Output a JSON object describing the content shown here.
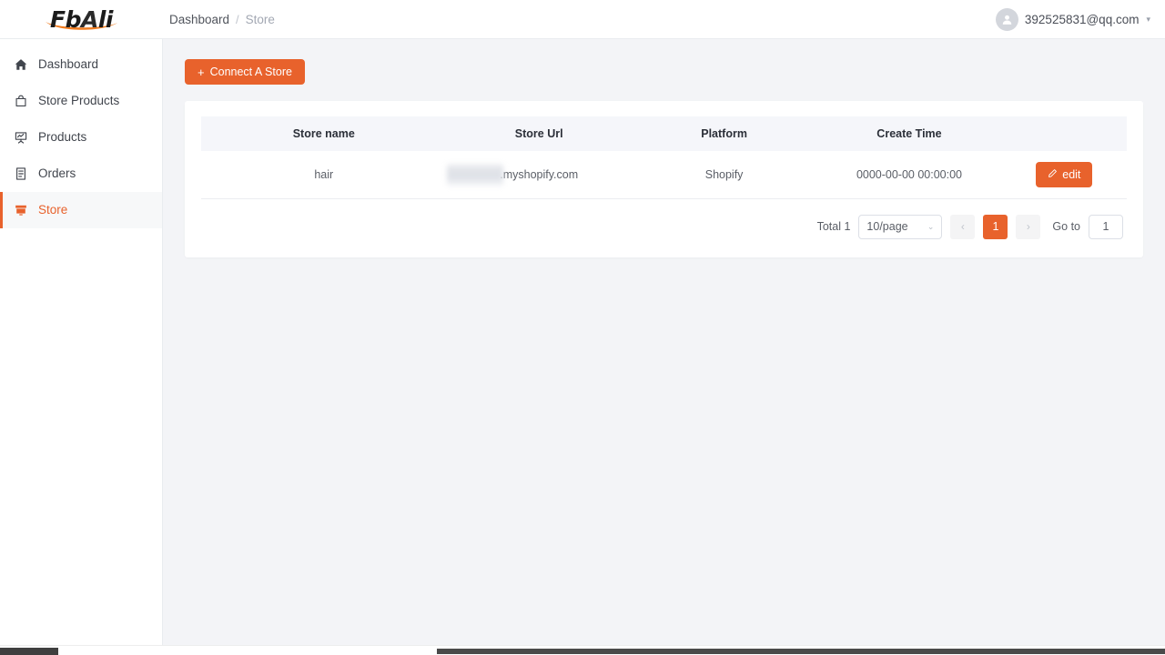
{
  "header": {
    "logo_text_1": "Fb",
    "logo_text_2": "A",
    "logo_text_3": "li",
    "logo_alt": "FbAli",
    "breadcrumb": {
      "parent": "Dashboard",
      "separator": "/",
      "current": "Store"
    },
    "user": {
      "email": "392525831@qq.com",
      "caret": "▾"
    }
  },
  "sidebar": {
    "items": [
      {
        "label": "Dashboard",
        "icon": "home-icon",
        "active": false
      },
      {
        "label": "Store Products",
        "icon": "shopping-bag-icon",
        "active": false
      },
      {
        "label": "Products",
        "icon": "presentation-board-icon",
        "active": false
      },
      {
        "label": "Orders",
        "icon": "document-list-icon",
        "active": false
      },
      {
        "label": "Store",
        "icon": "storefront-icon",
        "active": true
      }
    ]
  },
  "main": {
    "connect_button": {
      "plus": "+",
      "label": "Connect A Store"
    },
    "table": {
      "columns": [
        "Store name",
        "Store Url",
        "Platform",
        "Create Time"
      ],
      "action_column_label": "",
      "rows": [
        {
          "store_name": "hair",
          "store_url": ".myshopify.com",
          "store_url_redacted": true,
          "platform": "Shopify",
          "create_time": "0000-00-00 00:00:00",
          "edit_label": "edit"
        }
      ]
    },
    "pagination": {
      "total_label": "Total 1",
      "page_size": "10/page",
      "page_size_caret": "⌄",
      "prev_arrow": "‹",
      "next_arrow": "›",
      "current_page": "1",
      "goto_label": "Go to",
      "goto_value": "1"
    }
  },
  "colors": {
    "accent": "#e8622c",
    "page_background": "#f3f4f7",
    "card_background": "#ffffff",
    "table_header_background": "#f5f6fa",
    "sidebar_active_background": "#f7f8f9",
    "text_primary": "#41454d",
    "text_muted": "#a3a8b3"
  }
}
